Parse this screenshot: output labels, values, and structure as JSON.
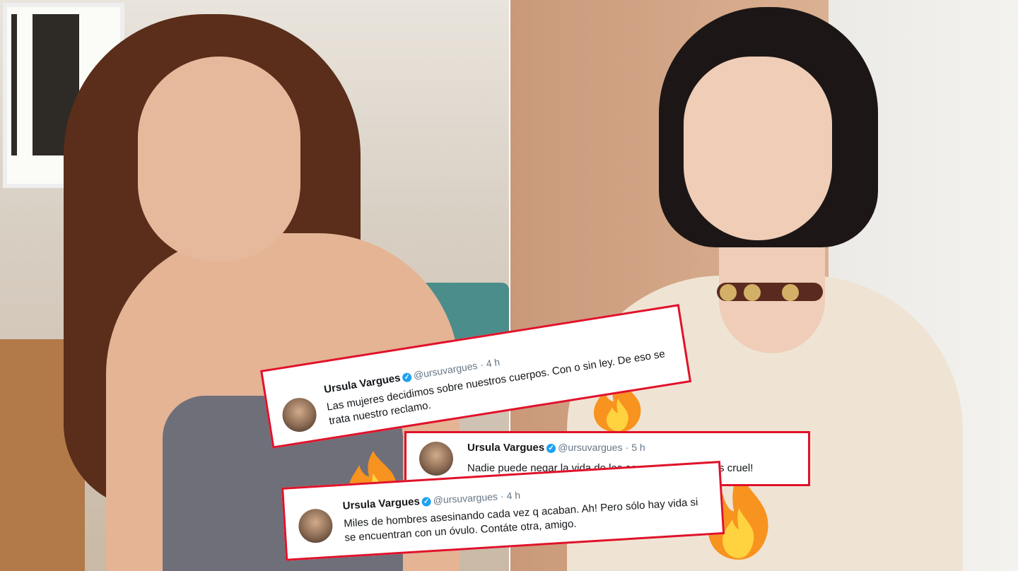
{
  "tweets": [
    {
      "name": "Ursula Vargues",
      "handle": "@ursuvargues",
      "time": "· 4 h",
      "text": "Las mujeres decidimos sobre nuestros cuerpos. Con o sin ley. De eso se trata nuestro reclamo."
    },
    {
      "name": "Ursula Vargues",
      "handle": "@ursuvargues",
      "time": "· 5 h",
      "text": "Nadie puede negar la vida de los espermatozoides. Es cruel!"
    },
    {
      "name": "Ursula Vargues",
      "handle": "@ursuvargues",
      "time": "· 4 h",
      "text": "Miles de hombres asesinando cada vez q acaban. Ah! Pero sólo hay vida si se encuentran con un óvulo. Contáte otra, amigo."
    }
  ],
  "icons": [
    "verified-badge-icon",
    "fire-icon"
  ],
  "colors": {
    "tweet_border": "#e0122a",
    "verified": "#1da1f2",
    "fire_outer": "#f7931e",
    "fire_inner": "#ffd23f"
  }
}
